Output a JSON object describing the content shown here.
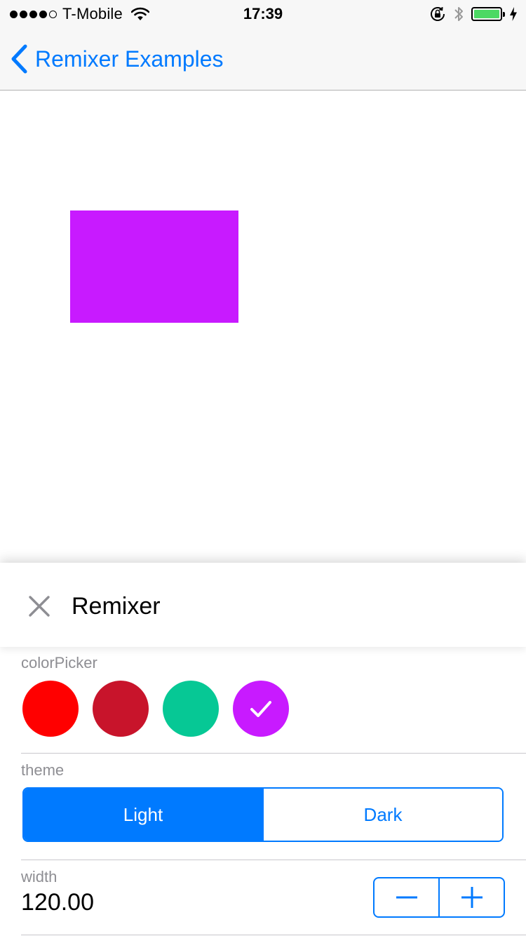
{
  "status_bar": {
    "carrier": "T-Mobile",
    "time": "17:39",
    "signal_bars_filled": 4,
    "signal_bars_total": 5,
    "battery_color": "#4cd964",
    "icons": [
      "wifi-icon",
      "rotation-lock-icon",
      "bluetooth-icon",
      "battery-icon",
      "charging-bolt-icon"
    ]
  },
  "nav": {
    "back_label": "Remixer Examples",
    "accent_color": "#007aff"
  },
  "preview": {
    "box_color": "#c81aff"
  },
  "remixer_panel": {
    "title": "Remixer",
    "color_picker": {
      "label": "colorPicker",
      "options": [
        "#ff0000",
        "#c8142b",
        "#06c895",
        "#c81aff"
      ],
      "selected_index": 3
    },
    "theme": {
      "label": "theme",
      "options": [
        "Light",
        "Dark"
      ],
      "selected": "Light"
    },
    "width": {
      "label": "width",
      "value": "120.00"
    }
  }
}
